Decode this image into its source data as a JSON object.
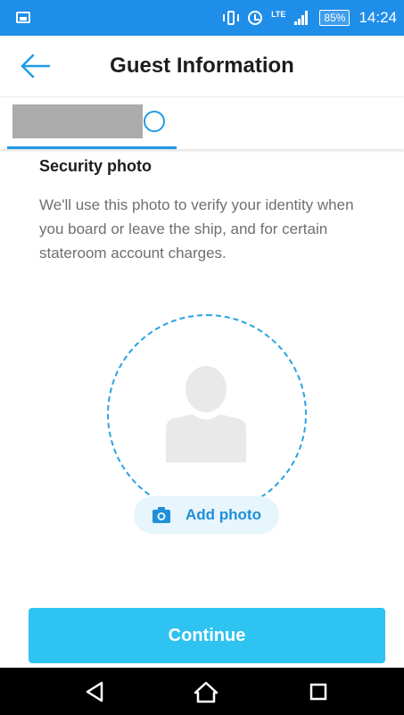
{
  "status_bar": {
    "battery": "85%",
    "time": "14:24",
    "network": "LTE",
    "color": "#1f8ee8"
  },
  "header": {
    "title": "Guest Information",
    "back_icon": "arrow-left-icon"
  },
  "tabs": {
    "active_tab_status_icon": "circle-outline-icon",
    "accent": "#1f9be6"
  },
  "security": {
    "title": "Security photo",
    "description": "We'll use this photo to verify your identity when you board or leave the ship, and for certain stateroom account charges.",
    "add_photo_label": "Add photo",
    "placeholder_icon": "person-silhouette-icon",
    "camera_icon": "camera-icon"
  },
  "actions": {
    "continue_label": "Continue",
    "continue_color": "#2ec3f1"
  },
  "nav_bar": {
    "back": "triangle-back-icon",
    "home": "home-icon",
    "recents": "square-recents-icon"
  }
}
